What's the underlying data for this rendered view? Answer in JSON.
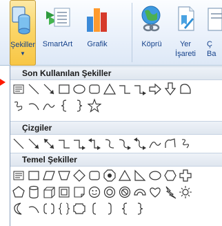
{
  "ribbon": {
    "buttons": [
      {
        "id": "sekiller",
        "label": "Şekiller",
        "icon": "shapes-icon",
        "active": true,
        "has_dropdown": true
      },
      {
        "id": "smartart",
        "label": "SmartArt",
        "icon": "smartart-icon",
        "active": false
      },
      {
        "id": "grafik",
        "label": "Grafik",
        "icon": "chart-icon",
        "active": false
      },
      {
        "id": "kopru",
        "label": "Köprü",
        "icon": "hyperlink-icon",
        "active": false
      },
      {
        "id": "yer-isareti",
        "label": "Yer",
        "label2": "İşareti",
        "icon": "bookmark-icon",
        "active": false
      },
      {
        "id": "capraz",
        "label": "Ç",
        "label2": "Ba",
        "icon": "crossref-icon",
        "active": false
      }
    ]
  },
  "gallery": {
    "sections": [
      {
        "title": "Son Kullanılan Şekiller",
        "rows": [
          [
            "textbox",
            "line",
            "arrow-line",
            "rectangle",
            "oval",
            "rounded-rectangle",
            "triangle",
            "elbow-connector",
            "elbow-arrow-connector",
            "right-arrow",
            "down-arrow",
            "flowchart-delay"
          ],
          [
            "freeform",
            "arc",
            "curve",
            "left-brace",
            "right-brace",
            "star-5"
          ]
        ]
      },
      {
        "title": "Çizgiler",
        "rows": [
          [
            "line",
            "arrow-line",
            "double-arrow-line",
            "elbow-connector",
            "elbow-arrow-connector",
            "elbow-double-arrow-connector",
            "curved-connector",
            "curved-arrow-connector",
            "curved-double-arrow-connector",
            "curve",
            "freeform-polygon",
            "scribble"
          ]
        ]
      },
      {
        "title": "Temel Şekiller",
        "rows": [
          [
            "textbox",
            "rectangle",
            "parallelogram",
            "trapezoid",
            "diamond",
            "rounded-rectangle",
            "octagon-circle",
            "triangle",
            "right-triangle",
            "oval",
            "hexagon",
            "cross"
          ],
          [
            "pentagon",
            "can",
            "cube",
            "bevel",
            "donut",
            "smiley",
            "no-symbol",
            "block-arc",
            "heart",
            "lightning",
            "sun",
            "moon"
          ],
          [
            "moon",
            "arc",
            "bracket-pair",
            "brace-pair",
            "plaque",
            "left-bracket",
            "right-bracket",
            "left-brace",
            "right-brace"
          ]
        ]
      }
    ]
  },
  "colors": {
    "accent": "#15428b",
    "active_button": "#fbd668",
    "pointer": "#ff1a00"
  }
}
